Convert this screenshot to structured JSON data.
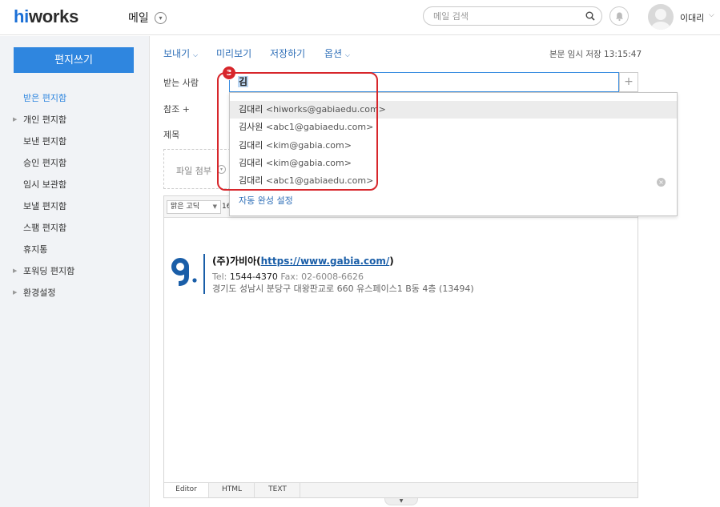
{
  "header": {
    "logo_hi": "hi",
    "logo_rest": "works",
    "app_title": "메일",
    "app_chevron": "chevron-down-icon",
    "search_placeholder": "메일 검색",
    "user_name": "이대리"
  },
  "sidebar": {
    "compose_label": "편지쓰기",
    "items": [
      {
        "label": "받은 편지함",
        "active": true,
        "expandable": false
      },
      {
        "label": "개인 편지함",
        "active": false,
        "expandable": true
      },
      {
        "label": "보낸 편지함",
        "active": false,
        "expandable": false
      },
      {
        "label": "승인 편지함",
        "active": false,
        "expandable": false
      },
      {
        "label": "임시 보관함",
        "active": false,
        "expandable": false
      },
      {
        "label": "보낼 편지함",
        "active": false,
        "expandable": false
      },
      {
        "label": "스팸 편지함",
        "active": false,
        "expandable": false
      },
      {
        "label": "휴지통",
        "active": false,
        "expandable": false
      },
      {
        "label": "포워딩 편지함",
        "active": false,
        "expandable": true
      },
      {
        "label": "환경설정",
        "active": false,
        "expandable": true
      }
    ]
  },
  "toolbar": {
    "send_label": "보내기",
    "preview_label": "미리보기",
    "save_label": "저장하기",
    "options_label": "옵션",
    "save_status": "본문 임시 저장 13:15:47"
  },
  "form": {
    "to_label": "받는 사람",
    "to_value": "김",
    "cc_label": "참조 +",
    "subject_label": "제목",
    "attach_label": "파일 첨부",
    "step_badge": "3",
    "add_recipient": "+"
  },
  "autocomplete": {
    "items": [
      {
        "name": "김대리",
        "email": "<hiworks@gabiaedu.com>",
        "selected": true
      },
      {
        "name": "김사원",
        "email": "<abc1@gabiaedu.com>",
        "selected": false
      },
      {
        "name": "김대리",
        "email": "<kim@gabia.com>",
        "selected": false
      },
      {
        "name": "김대리",
        "email": "<kim@gabia.com>",
        "selected": false
      },
      {
        "name": "김대리",
        "email": "<abc1@gabiaedu.com>",
        "selected": false
      }
    ],
    "settings_label": "자동 완성 설정",
    "clear_icon": "x"
  },
  "editor": {
    "font_name": "맑은 고딕",
    "font_size": "16",
    "signature": {
      "company": "(주)가비아(",
      "url": "https://www.gabia.com/",
      "company_close": ")",
      "tel_label": "Tel:",
      "tel_value": "1544-4370",
      "fax": "Fax: 02-6008-6626",
      "address": "경기도 성남시 분당구 대왕판교로 660 유스페이스1 B동 4층 (13494)"
    },
    "tabs": [
      "Editor",
      "HTML",
      "TEXT"
    ],
    "active_tab": "Editor"
  },
  "colors": {
    "accent": "#2f86df",
    "link": "#2f6fb8",
    "highlight": "#d7262b"
  }
}
